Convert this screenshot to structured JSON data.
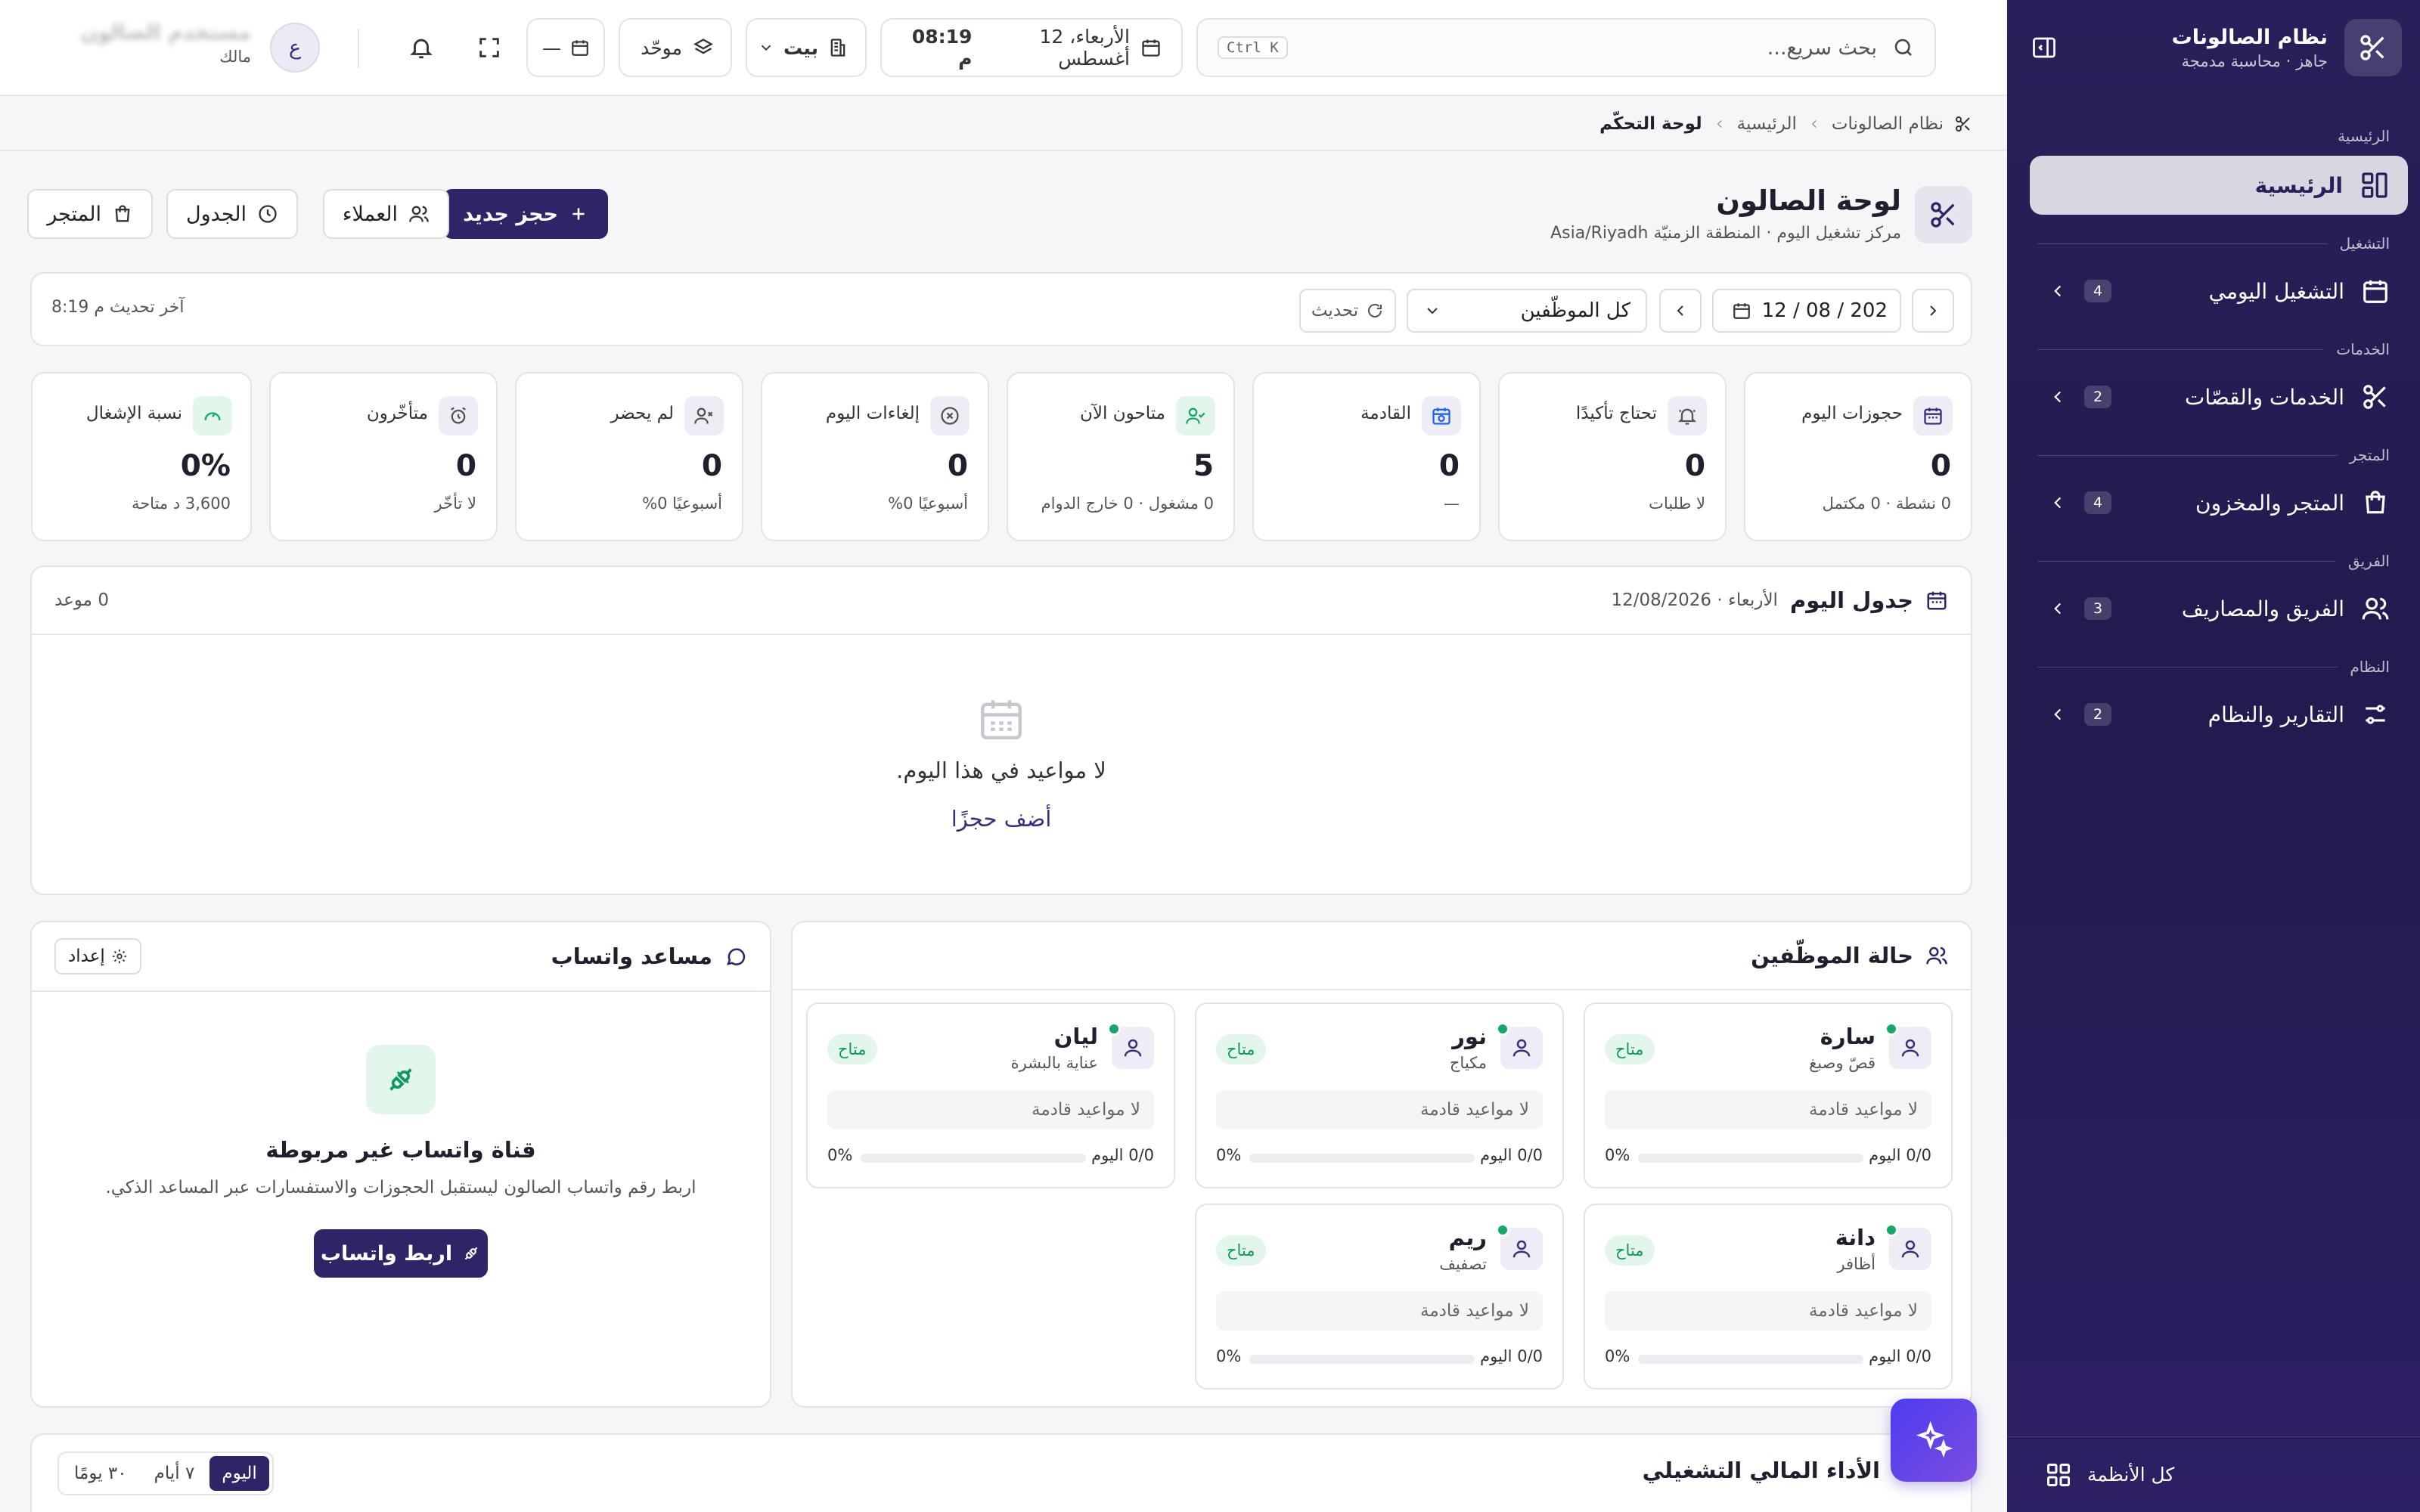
{
  "app": {
    "name": "نظام الصالونات",
    "subtitle": "جاهز · محاسبة مدمجة"
  },
  "sidebar": {
    "sections": [
      {
        "title": "الرئيسية",
        "item": {
          "label": "الرئيسية",
          "icon": "dashboard-icon",
          "badge": ""
        }
      },
      {
        "title": "التشغيل",
        "item": {
          "label": "التشغيل اليومي",
          "icon": "calendar-icon",
          "badge": "4"
        }
      },
      {
        "title": "الخدمات",
        "item": {
          "label": "الخدمات والقصّات",
          "icon": "scissors-icon",
          "badge": "2"
        }
      },
      {
        "title": "المتجر",
        "item": {
          "label": "المتجر والمخزون",
          "icon": "shopping-bag-icon",
          "badge": "4"
        }
      },
      {
        "title": "الفريق",
        "item": {
          "label": "الفريق والمصاريف",
          "icon": "users-icon",
          "badge": "3"
        }
      },
      {
        "title": "النظام",
        "item": {
          "label": "التقارير والنظام",
          "icon": "sliders-icon",
          "badge": "2"
        }
      }
    ],
    "footer": "كل الأنظمة"
  },
  "topbar": {
    "search_placeholder": "بحث سريع...",
    "search_shortcut": "Ctrl K",
    "datetime": "الأربعاء، 12 أغسطس",
    "time": "08:19 م",
    "branch": "بيت",
    "view": "موحّد",
    "calendar_value": "—",
    "avatar_initial": "ع",
    "user_name": "مستخدم الصالون",
    "user_role": "مالك"
  },
  "breadcrumb": [
    "نظام الصالونات",
    "الرئيسية",
    "لوحة التحكّم"
  ],
  "page": {
    "title": "لوحة الصالون",
    "subtitle": "مركز تشغيل اليوم · المنطقة الزمنيّة Asia/Riyadh",
    "actions": {
      "new_booking": "حجز جديد",
      "clients": "العملاء",
      "schedule": "الجدول",
      "store": "المتجر"
    }
  },
  "filters": {
    "date": "12 / 08 / 202",
    "staff": "كل الموظّفين",
    "refresh": "تحديث",
    "last_update": "آخر تحديث م 8:19"
  },
  "stats": [
    {
      "label": "حجوزات اليوم",
      "value": "0",
      "sub": "0 نشطة · 0 مكتمل",
      "icon": "calendar-icon"
    },
    {
      "label": "تحتاج تأكيدًا",
      "value": "0",
      "sub": "لا طلبات",
      "icon": "bell-icon"
    },
    {
      "label": "القادمة",
      "value": "0",
      "sub": "—",
      "icon": "calendar-clock-icon"
    },
    {
      "label": "متاحون الآن",
      "value": "5",
      "sub": "0 مشغول · 0 خارج الدوام",
      "icon": "user-check-icon"
    },
    {
      "label": "إلغاءات اليوم",
      "value": "0",
      "sub": "أسبوعيًا 0%",
      "icon": "x-circle-icon"
    },
    {
      "label": "لم يحضر",
      "value": "0",
      "sub": "أسبوعيًا 0%",
      "icon": "user-x-icon"
    },
    {
      "label": "متأخّرون",
      "value": "0",
      "sub": "لا تأخّر",
      "icon": "alarm-icon"
    },
    {
      "label": "نسبة الإشغال",
      "value": "0%",
      "sub": "3,600 د متاحة",
      "icon": "gauge-icon"
    }
  ],
  "schedule": {
    "title": "جدول اليوم",
    "date": "الأربعاء · 12/08/2026",
    "count": "0 موعد",
    "empty_text": "لا مواعيد في هذا اليوم.",
    "empty_action": "أضف حجزًا"
  },
  "staff_status": {
    "title": "حالة الموظّفين",
    "members": [
      {
        "name": "سارة",
        "role": "قصّ وصبغ",
        "status": "متاح",
        "upcoming": "لا مواعيد قادمة",
        "count": "0/0 اليوم",
        "pct": "0%",
        "progress": 0
      },
      {
        "name": "نور",
        "role": "مكياج",
        "status": "متاح",
        "upcoming": "لا مواعيد قادمة",
        "count": "0/0 اليوم",
        "pct": "0%",
        "progress": 0
      },
      {
        "name": "ليان",
        "role": "عناية بالبشرة",
        "status": "متاح",
        "upcoming": "لا مواعيد قادمة",
        "count": "0/0 اليوم",
        "pct": "0%",
        "progress": 0
      },
      {
        "name": "دانة",
        "role": "أظافر",
        "status": "متاح",
        "upcoming": "لا مواعيد قادمة",
        "count": "0/0 اليوم",
        "pct": "0%",
        "progress": 0
      },
      {
        "name": "ريم",
        "role": "تصفيف",
        "status": "متاح",
        "upcoming": "لا مواعيد قادمة",
        "count": "0/0 اليوم",
        "pct": "0%",
        "progress": 0
      }
    ]
  },
  "whatsapp": {
    "title": "مساعد واتساب",
    "setup": "إعداد",
    "headline": "قناة واتساب غير مربوطة",
    "description": "اربط رقم واتساب الصالون ليستقبل الحجوزات والاستفسارات عبر المساعد الذكي.",
    "button": "اربط واتساب"
  },
  "finance": {
    "title": "الأداء المالي التشغيلي",
    "tabs": [
      "اليوم",
      "٧ أيام",
      "٣٠ يومًا"
    ],
    "active_tab": "اليوم"
  },
  "colors": {
    "primary": "#2e2466",
    "sidebar": "#2a1f5a",
    "success": "#16a86b",
    "accent": "#5b45ee"
  }
}
